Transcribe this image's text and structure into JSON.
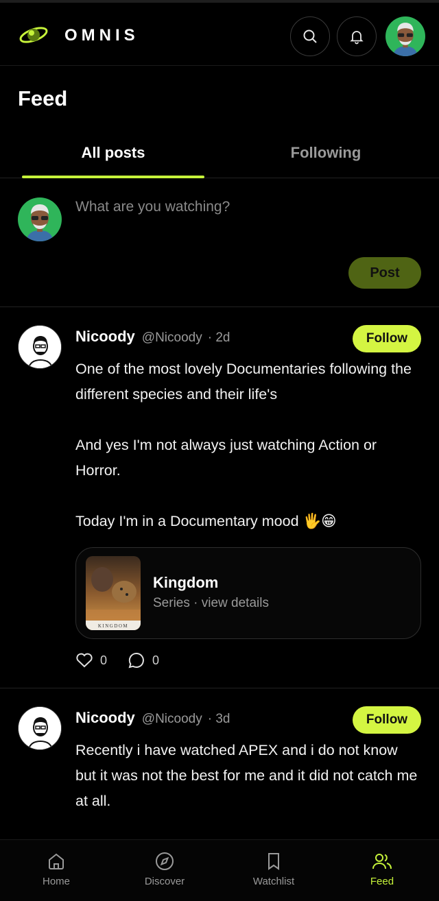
{
  "app": {
    "brand": "OMNIS"
  },
  "header": {
    "search_icon": "search-icon",
    "bell_icon": "bell-icon"
  },
  "page": {
    "title": "Feed"
  },
  "tabs": [
    {
      "label": "All posts",
      "active": true
    },
    {
      "label": "Following",
      "active": false
    }
  ],
  "composer": {
    "placeholder": "What are you watching?",
    "post_label": "Post"
  },
  "posts": [
    {
      "author": "Nicoody",
      "handle": "@Nicoody",
      "age": "· 2d",
      "follow_label": "Follow",
      "body": [
        "One of the most lovely Documentaries following the different species and their life's",
        "And yes I'm not always just watching Action or Horror.",
        "Today I'm in a Documentary mood 🖐😁"
      ],
      "media": {
        "title": "Kingdom",
        "subtitle": "Series · view details",
        "poster_text": "KINGDOM"
      },
      "likes": "0",
      "comments": "0"
    },
    {
      "author": "Nicoody",
      "handle": "@Nicoody",
      "age": "· 3d",
      "follow_label": "Follow",
      "body": [
        "Recently i have watched APEX and i do not know but it was not the best for me and it did not catch me at all."
      ]
    }
  ],
  "nav": [
    {
      "label": "Home",
      "icon": "home-icon",
      "active": false
    },
    {
      "label": "Discover",
      "icon": "compass-icon",
      "active": false
    },
    {
      "label": "Watchlist",
      "icon": "bookmark-icon",
      "active": false
    },
    {
      "label": "Feed",
      "icon": "users-icon",
      "active": true
    }
  ],
  "colors": {
    "accent": "#d4f542",
    "background": "#000000",
    "muted": "#9a9a9a",
    "post_disabled": "#4f6414"
  }
}
